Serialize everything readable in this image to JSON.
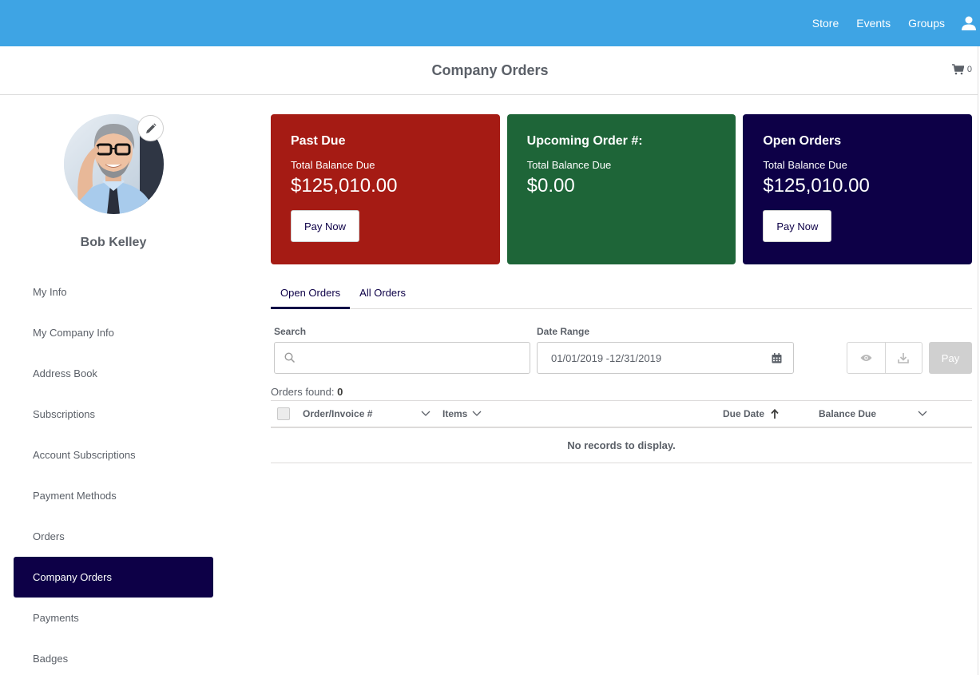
{
  "topnav": {
    "links": [
      "Store",
      "Events",
      "Groups"
    ],
    "user_icon": "user-icon",
    "color": "#3ea4e4"
  },
  "header": {
    "title": "Company Orders",
    "cart_count": "0",
    "cart_icon": "cart-icon"
  },
  "profile": {
    "name": "Bob Kelley",
    "edit_icon": "pencil-icon"
  },
  "sidebar": {
    "items": [
      {
        "label": "My Info"
      },
      {
        "label": "My Company Info"
      },
      {
        "label": "Address Book"
      },
      {
        "label": "Subscriptions"
      },
      {
        "label": "Account Subscriptions"
      },
      {
        "label": "Payment Methods"
      },
      {
        "label": "Orders"
      },
      {
        "label": "Company Orders",
        "active": true
      },
      {
        "label": "Payments"
      },
      {
        "label": "Badges"
      }
    ],
    "active_color": "#0d0047"
  },
  "cards": [
    {
      "title": "Past Due",
      "subtitle": "Total Balance Due",
      "amount": "$125,010.00",
      "button": "Pay Now",
      "color": "#a51b14"
    },
    {
      "title": "Upcoming Order #:",
      "subtitle": "Total Balance Due",
      "amount": "$0.00",
      "color": "#1e6538"
    },
    {
      "title": "Open Orders",
      "subtitle": "Total Balance Due",
      "amount": "$125,010.00",
      "button": "Pay Now",
      "color": "#0d0047"
    }
  ],
  "tabs": [
    {
      "label": "Open Orders",
      "active": true
    },
    {
      "label": "All Orders"
    }
  ],
  "filters": {
    "search_label": "Search",
    "search_value": "",
    "search_placeholder": "",
    "date_label": "Date Range",
    "date_value": "01/01/2019 -12/31/2019",
    "pay_label": "Pay"
  },
  "results": {
    "label": "Orders found:",
    "count": "0"
  },
  "table": {
    "columns": [
      "Order/Invoice #",
      "Items",
      "Due Date",
      "Balance Due"
    ],
    "empty_message": "No records to display."
  }
}
